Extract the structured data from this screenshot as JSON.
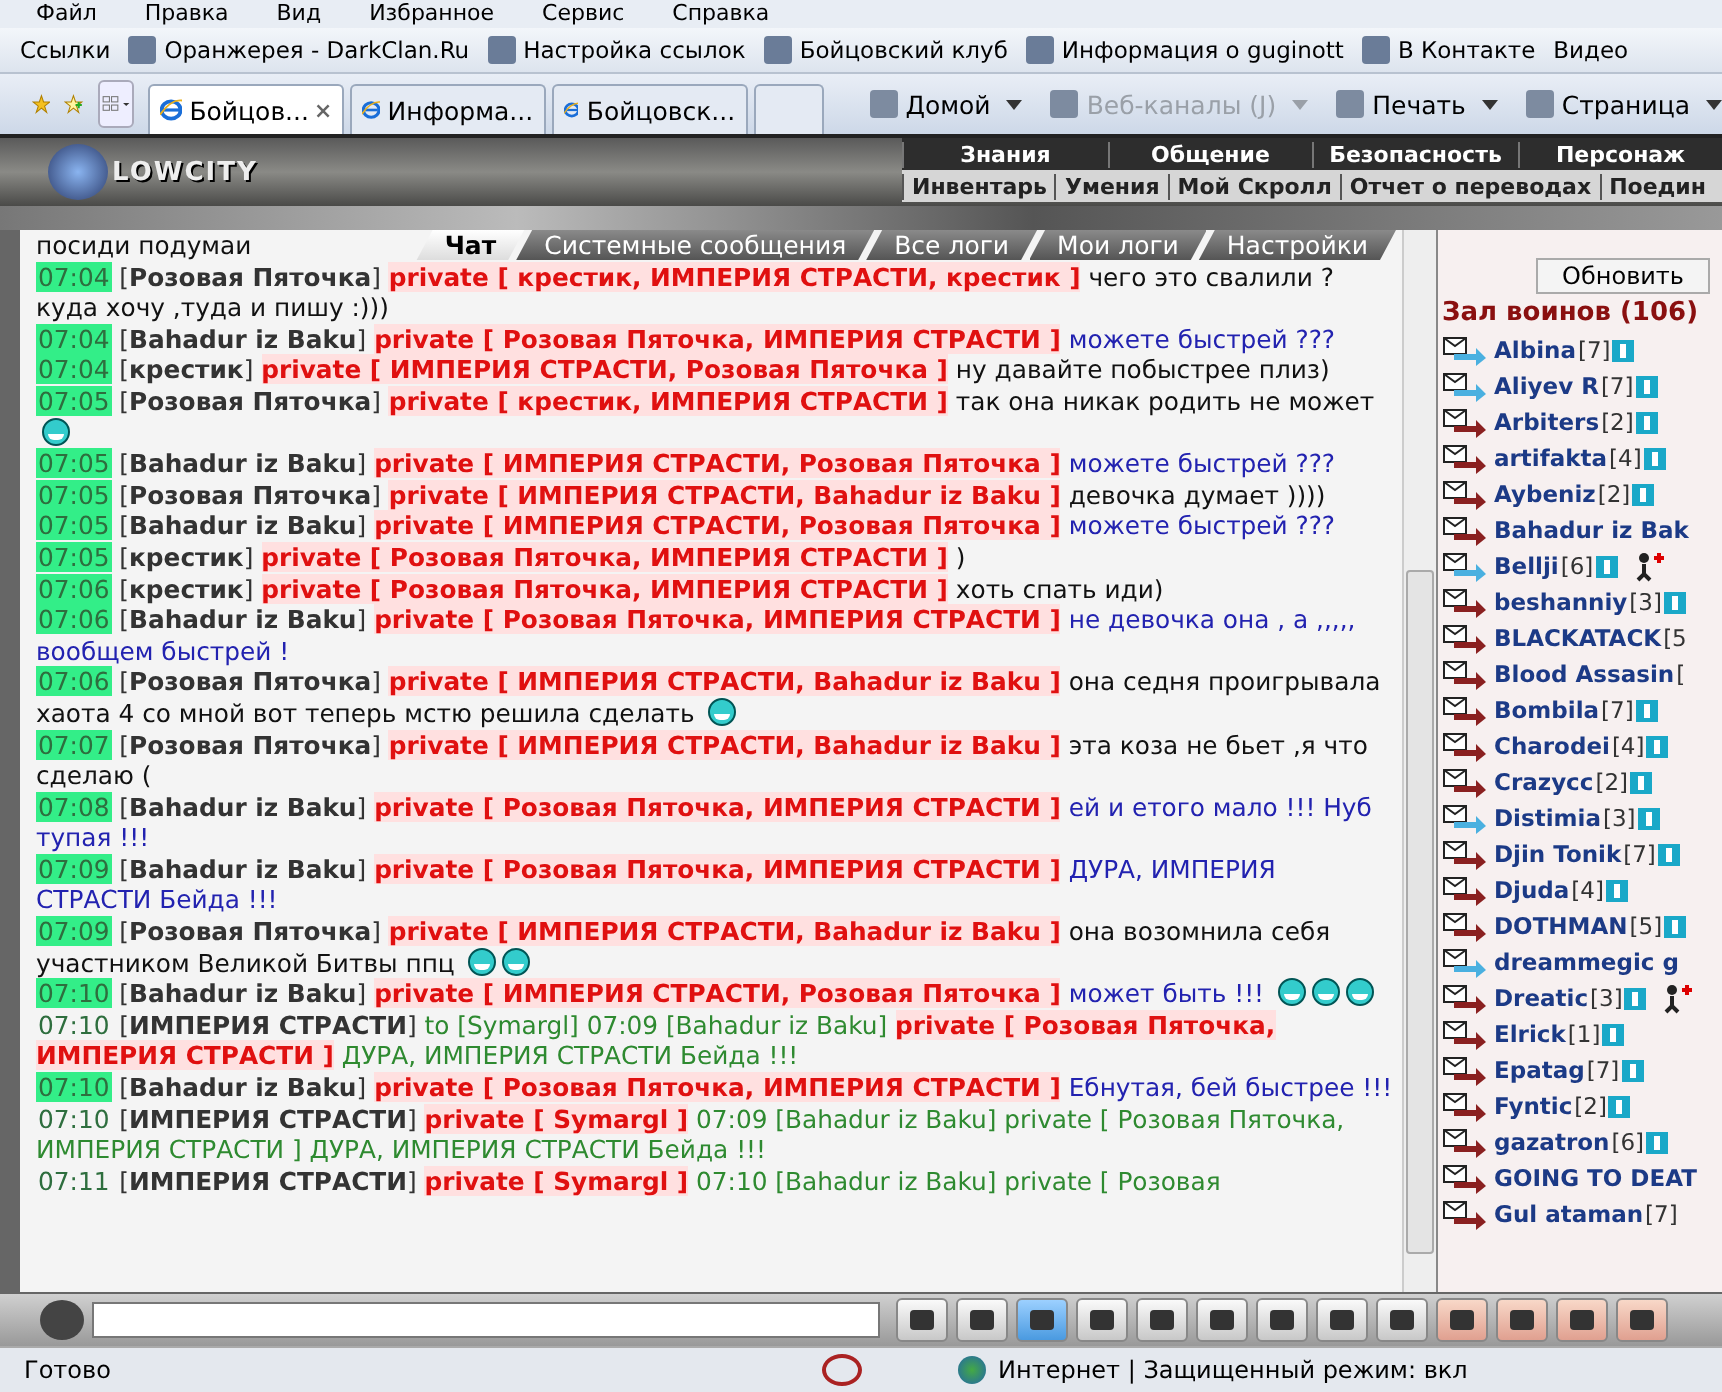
{
  "menu_bar": [
    "Файл",
    "Правка",
    "Вид",
    "Избранное",
    "Сервис",
    "Справка"
  ],
  "links_bar": {
    "label": "Ссылки",
    "links": [
      "Оранжерея - DarkClan.Ru",
      "Настройка ссылок",
      "Бойцовский клуб",
      "Информация о guginott",
      "В Контакте",
      "Видео"
    ]
  },
  "tabs": [
    {
      "label": "Бойцов...",
      "selected": true
    },
    {
      "label": "Информа...",
      "selected": false
    },
    {
      "label": "Бойцовск...",
      "selected": false
    }
  ],
  "command_bar": [
    {
      "label": "Домой",
      "disabled": false
    },
    {
      "label": "Веб-каналы (J)",
      "disabled": true
    },
    {
      "label": "Печать",
      "disabled": false
    },
    {
      "label": "Страница",
      "disabled": false
    }
  ],
  "game_header": {
    "logo": "LOWCITY",
    "top_nav": [
      "Знания",
      "Общение",
      "Безопасность",
      "Персонаж"
    ],
    "sub_nav": [
      "Инвентарь",
      "Умения",
      "Мой Скролл",
      "Отчет о переводах",
      "Поедин"
    ]
  },
  "chat_tabs": [
    {
      "label": "Чат",
      "selected": true
    },
    {
      "label": "Системные сообщения",
      "selected": false
    },
    {
      "label": "Все логи",
      "selected": false
    },
    {
      "label": "Мои логи",
      "selected": false
    },
    {
      "label": "Настройки",
      "selected": false
    }
  ],
  "chat_lead": "посиди подумаи",
  "messages": [
    {
      "time": "07:04",
      "highlighted": true,
      "sender": "[**Розовая Пяточка**]",
      "private": "private [ крестик, ИМПЕРИЯ СТРАСТИ, крестик ]",
      "text": "чего это свалили ?куда хочу ,туда и пишу :)))",
      "color": "#111111"
    },
    {
      "time": "07:04",
      "highlighted": true,
      "sender": "[**Bahadur iz Baku**]",
      "private": "private [ Розовая Пяточка, ИМПЕРИЯ СТРАСТИ ]",
      "text": "можете быстрей ???",
      "color": "#2222b0"
    },
    {
      "time": "07:04",
      "highlighted": true,
      "sender": "[**крестик**]",
      "private": "private [ ИМПЕРИЯ СТРАСТИ, Розовая Пяточка ]",
      "text": "ну давайте побыстрее плиз)",
      "color": "#111111"
    },
    {
      "time": "07:05",
      "highlighted": true,
      "sender": "[**Розовая Пяточка**]",
      "private": "private [ крестик, ИМПЕРИЯ СТРАСТИ ]",
      "text": "так она никак родить не может",
      "color": "#111111",
      "smileys": [
        {
          "kind": "grin"
        }
      ]
    },
    {
      "time": "07:05",
      "highlighted": true,
      "sender": "[**Bahadur iz Baku**]",
      "private": "private [ ИМПЕРИЯ СТРАСТИ, Розовая Пяточка ]",
      "text": "можете быстрей ???",
      "color": "#2222b0"
    },
    {
      "time": "07:05",
      "highlighted": true,
      "sender": "[**Розовая Пяточка**]",
      "private": "private [ ИМПЕРИЯ СТРАСТИ, Bahadur iz Baku ]",
      "text": "девочка думает ))))",
      "color": "#111111"
    },
    {
      "time": "07:05",
      "highlighted": true,
      "sender": "[**Bahadur iz Baku**]",
      "private": "private [ ИМПЕРИЯ СТРАСТИ, Розовая Пяточка ]",
      "text": "можете быстрей ???",
      "color": "#2222b0"
    },
    {
      "time": "07:05",
      "highlighted": true,
      "sender": "[**крестик**]",
      "private": "private [ Розовая Пяточка, ИМПЕРИЯ СТРАСТИ ]",
      "text": ")",
      "color": "#111111"
    },
    {
      "time": "07:06",
      "highlighted": true,
      "sender": "[**крестик**]",
      "private": "private [ Розовая Пяточка, ИМПЕРИЯ СТРАСТИ ]",
      "text": "хоть спать иди)",
      "color": "#111111"
    },
    {
      "time": "07:06",
      "highlighted": true,
      "sender": "[**Bahadur iz Baku**]",
      "private": "private [ Розовая Пяточка, ИМПЕРИЯ СТРАСТИ ]",
      "text": "не девочка она , а ,,,,, вообщем быстрей !",
      "color": "#2222b0"
    },
    {
      "time": "07:06",
      "highlighted": true,
      "sender": "[**Розовая Пяточка**]",
      "private": "private [ ИМПЕРИЯ СТРАСТИ, Bahadur iz Baku ]",
      "text": "она седня проигрывала хаота 4 со мной вот теперь мстю решила сделать",
      "color": "#111111",
      "smileys": [
        {
          "kind": "grin"
        }
      ]
    },
    {
      "time": "07:07",
      "highlighted": true,
      "sender": "[**Розовая Пяточка**]",
      "private": "private [ ИМПЕРИЯ СТРАСТИ, Bahadur iz Baku ]",
      "text": "эта коза не бьет ,я что сделаю (",
      "color": "#111111"
    },
    {
      "time": "07:08",
      "highlighted": true,
      "sender": "[**Bahadur iz Baku**]",
      "private": "private [ Розовая Пяточка, ИМПЕРИЯ СТРАСТИ ]",
      "text": "ей и етого мало !!! Нуб тупая !!!",
      "color": "#2222b0"
    },
    {
      "time": "07:09",
      "highlighted": true,
      "sender": "[**Bahadur iz Baku**]",
      "private": "private [ Розовая Пяточка, ИМПЕРИЯ СТРАСТИ ]",
      "text": "ДУРА, ИМПЕРИЯ СТРАСТИ Бейда !!!",
      "color": "#2222b0"
    },
    {
      "time": "07:09",
      "highlighted": true,
      "sender": "[**Розовая Пяточка**]",
      "private": "private [ ИМПЕРИЯ СТРАСТИ, Bahadur iz Baku ]",
      "text": "она возомнила себя участником Великой Битвы ппц",
      "color": "#111111",
      "smileys": [
        {
          "kind": "grin"
        },
        {
          "kind": "grin"
        }
      ]
    },
    {
      "time": "07:10",
      "highlighted": true,
      "sender": "[**Bahadur iz Baku**]",
      "private": "private [ ИМПЕРИЯ СТРАСТИ, Розовая Пяточка ]",
      "text": "может быть !!!",
      "color": "#2222b0",
      "smileys": [
        {
          "kind": "grin"
        },
        {
          "kind": "grin"
        },
        {
          "kind": "grin"
        }
      ]
    },
    {
      "time": "07:10",
      "highlighted": false,
      "sender": "[**ИМПЕРИЯ СТРАСТИ**]",
      "before": "to [Symargl] 07:09 [Bahadur iz Baku]",
      "private": "private [ Розовая Пяточка, ИМПЕРИЯ СТРАСТИ ]",
      "text": "ДУРА, ИМПЕРИЯ СТРАСТИ Бейда !!!",
      "color": "#2e8a30"
    },
    {
      "time": "07:10",
      "highlighted": true,
      "sender": "[**Bahadur iz Baku**]",
      "private": "private [ Розовая Пяточка, ИМПЕРИЯ СТРАСТИ ]",
      "text": "Ебнутая, бей быстрее !!!",
      "color": "#2222b0"
    },
    {
      "time": "07:10",
      "highlighted": false,
      "sender": "[**ИМПЕРИЯ СТРАСТИ**]",
      "private": "private [ Symargl ]",
      "text": "07:09 [Bahadur iz Baku] private [ Розовая Пяточка, ИМПЕРИЯ СТРАСТИ ] ДУРА, ИМПЕРИЯ СТРАСТИ Бейда !!!",
      "color": "#2e8a30"
    },
    {
      "time": "07:11",
      "highlighted": false,
      "sender": "[**ИМПЕРИЯ СТРАСТИ**]",
      "private": "private [ Symargl ]",
      "text": "07:10 [Bahadur iz Baku] private [ Розовая",
      "color": "#2e8a30"
    }
  ],
  "users_panel": {
    "refresh_button": "Обновить",
    "title": "Зал воинов (106)",
    "users": [
      {
        "name": "Albina",
        "rank": "[7]",
        "color": "#4ab0e0",
        "info": true,
        "helper": false
      },
      {
        "name": "Aliyev R",
        "rank": "[7]",
        "color": "#4ab0e0",
        "info": true,
        "helper": false
      },
      {
        "name": "Arbiters",
        "rank": "[2]",
        "color": "#8a2020",
        "info": true,
        "helper": false
      },
      {
        "name": "artifakta",
        "rank": "[4]",
        "color": "#8a2020",
        "info": true,
        "helper": false
      },
      {
        "name": "Aybeniz",
        "rank": "[2]",
        "color": "#8a2020",
        "info": true,
        "helper": false
      },
      {
        "name": "Bahadur iz Bak",
        "color": "#8a2020",
        "info": false,
        "helper": false
      },
      {
        "name": "Bellji",
        "rank": "[6]",
        "color": "#4ab0e0",
        "info": true,
        "helper": true
      },
      {
        "name": "beshanniy",
        "rank": "[3]",
        "color": "#8a2020",
        "info": true,
        "helper": false
      },
      {
        "name": "BLACKATACK",
        "rank": "[5",
        "color": "#8a2020",
        "info": false,
        "helper": false
      },
      {
        "name": "Blood Assasin",
        "rank": "[",
        "color": "#8a2020",
        "info": false,
        "helper": false
      },
      {
        "name": "Bombila",
        "rank": "[7]",
        "color": "#8a2020",
        "info": true,
        "helper": false
      },
      {
        "name": "Charodei",
        "rank": "[4]",
        "color": "#8a2020",
        "info": true,
        "helper": false
      },
      {
        "name": "Crazycc",
        "rank": "[2]",
        "color": "#8a2020",
        "info": true,
        "helper": false
      },
      {
        "name": "Distimia",
        "rank": "[3]",
        "color": "#4ab0e0",
        "info": true,
        "helper": false
      },
      {
        "name": "Djin Tonik",
        "rank": "[7]",
        "color": "#8a2020",
        "info": true,
        "helper": false
      },
      {
        "name": "Djuda",
        "rank": "[4]",
        "color": "#8a2020",
        "info": true,
        "helper": false
      },
      {
        "name": "DOTHMAN",
        "rank": "[5]",
        "color": "#8a2020",
        "info": true,
        "helper": false
      },
      {
        "name": "dreammegic g",
        "color": "#4ab0e0",
        "info": false,
        "helper": false
      },
      {
        "name": "Dreatic",
        "rank": "[3]",
        "color": "#8a2020",
        "info": true,
        "helper": true
      },
      {
        "name": "Elrick",
        "rank": "[1]",
        "color": "#8a2020",
        "info": true,
        "helper": false
      },
      {
        "name": "Epatag",
        "rank": "[7]",
        "color": "#8a2020",
        "info": true,
        "helper": false
      },
      {
        "name": "Fyntic",
        "rank": "[2]",
        "color": "#8a2020",
        "info": true,
        "helper": false
      },
      {
        "name": "gazatron",
        "rank": "[6]",
        "color": "#8a2020",
        "info": true,
        "helper": false
      },
      {
        "name": "GOING TO DEAT",
        "color": "#8a2020",
        "info": false,
        "helper": false
      },
      {
        "name": "Gul ataman",
        "rank": "[7]",
        "color": "#8a2020",
        "info": false,
        "helper": false
      }
    ]
  },
  "chat_toolbar": {
    "filter_active": true
  },
  "status_bar": {
    "status": "Готово",
    "zone": "Интернет | Защищенный режим: вкл"
  }
}
